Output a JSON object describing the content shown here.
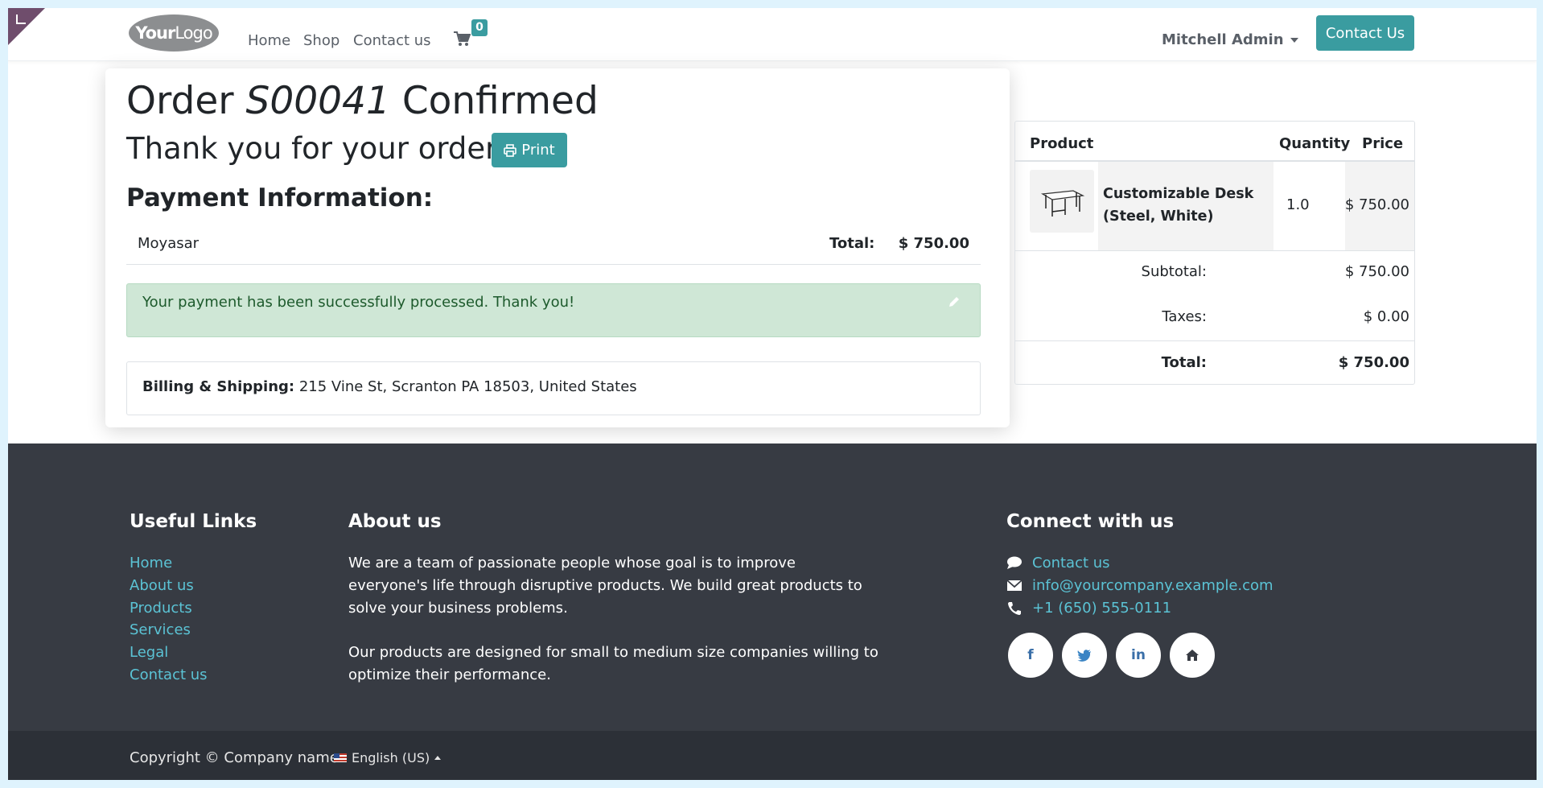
{
  "header": {
    "logo_bold": "Your",
    "logo_light": "Logo",
    "nav": [
      "Home",
      "Shop",
      "Contact us"
    ],
    "cart_count": "0",
    "user": "Mitchell Admin",
    "contact_button": "Contact Us"
  },
  "order": {
    "title_prefix": "Order ",
    "order_number": "S00041",
    "title_suffix": " Confirmed",
    "thanks": "Thank you for your order.",
    "print_label": "Print",
    "payment_heading": "Payment Information:",
    "payment_method": "Moyasar",
    "total_label": "Total:",
    "total_value": "$ 750.00",
    "alert_message": "Your payment has been successfully processed. Thank you!",
    "billing_label": "Billing & Shipping:",
    "billing_address": " 215 Vine St, Scranton PA 18503, United States"
  },
  "summary": {
    "col_product": "Product",
    "col_quantity": "Quantity",
    "col_price": "Price",
    "product_name": "Customizable Desk (Steel, White)",
    "quantity": "1.0",
    "price": "$ 750.00",
    "subtotal_label": "Subtotal:",
    "subtotal_value": "$ 750.00",
    "taxes_label": "Taxes:",
    "taxes_value": "$ 0.00",
    "total_label": "Total:",
    "total_value": "$ 750.00"
  },
  "footer": {
    "useful_links_heading": "Useful Links",
    "useful_links": [
      "Home",
      "About us",
      "Products",
      "Services",
      "Legal",
      "Contact us"
    ],
    "about_heading": "About us",
    "about_p1": "We are a team of passionate people whose goal is to improve everyone's life through disruptive products. We build great products to solve your business problems.",
    "about_p2": "Our products are designed for small to medium size companies willing to optimize their performance.",
    "connect_heading": "Connect with us",
    "contact_link": "Contact us",
    "email": "info@yourcompany.example.com",
    "phone": "+1 (650) 555-0111",
    "social": [
      "f",
      "t",
      "in",
      "home"
    ],
    "copyright": "Copyright © Company name",
    "language": "English (US)"
  },
  "colors": {
    "primary": "#3a9ca0",
    "footer_bg": "#373b43",
    "link": "#5bc3d5",
    "alert_bg": "#cfe7d6"
  }
}
